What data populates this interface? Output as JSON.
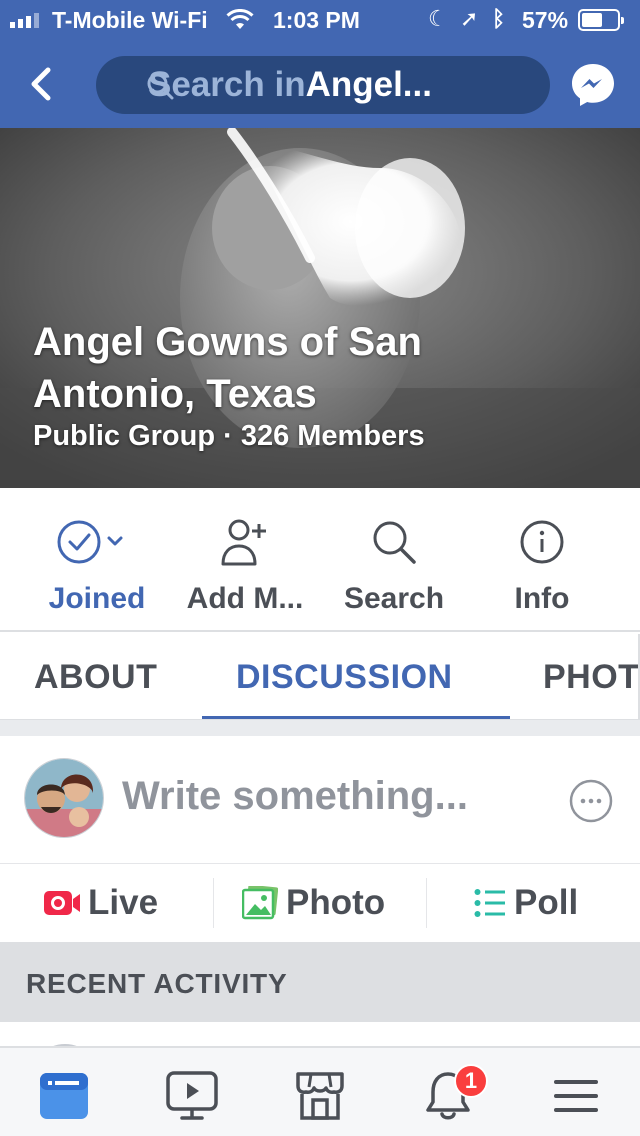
{
  "status_bar": {
    "carrier": "T-Mobile Wi-Fi",
    "time": "1:03 PM",
    "battery": "57%",
    "battery_level": 0.57,
    "icons": [
      "signal-icon",
      "wifi-icon",
      "moon-icon",
      "location-icon",
      "bluetooth-icon",
      "battery-icon"
    ]
  },
  "nav": {
    "search_prefix": "Search in ",
    "search_group": "Angel...",
    "icons": [
      "back-icon",
      "search-icon",
      "messenger-icon"
    ]
  },
  "group": {
    "name": "Angel Gowns of San Antonio, Texas",
    "meta": "Public Group · 326 Members"
  },
  "actions": [
    {
      "label": "Joined",
      "icon": "check-circle-icon"
    },
    {
      "label": "Add M...",
      "icon": "add-member-icon"
    },
    {
      "label": "Search",
      "icon": "search-icon"
    },
    {
      "label": "Info",
      "icon": "info-icon"
    }
  ],
  "tabs": [
    "ABOUT",
    "DISCUSSION",
    "PHOT"
  ],
  "active_tab": "DISCUSSION",
  "composer": {
    "placeholder": "Write something..."
  },
  "post_actions": [
    {
      "label": "Live",
      "icon": "live-icon"
    },
    {
      "label": "Photo",
      "icon": "photo-icon"
    },
    {
      "label": "Poll",
      "icon": "poll-icon"
    }
  ],
  "section": {
    "recent_activity": "RECENT ACTIVITY"
  },
  "tab_bar": {
    "items": [
      "news-feed-icon",
      "watch-icon",
      "marketplace-icon",
      "notifications-icon",
      "menu-icon"
    ],
    "notification_badge": "1"
  },
  "colors": {
    "brand": "#4267b2",
    "brand_dark": "#29487d",
    "badge": "#fa3e3e",
    "live": "#f02849",
    "photo": "#45bd62",
    "poll": "#2abba7"
  }
}
